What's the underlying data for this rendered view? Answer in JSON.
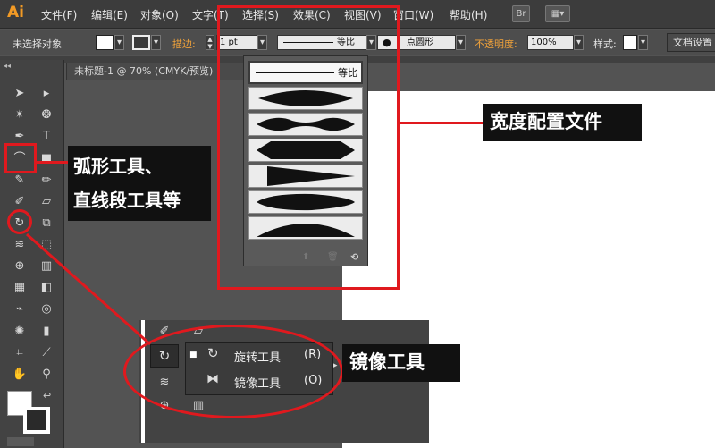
{
  "app": {
    "logo": "Ai"
  },
  "menubar": {
    "items": [
      "文件(F)",
      "编辑(E)",
      "对象(O)",
      "文字(T)",
      "选择(S)",
      "效果(C)",
      "视图(V)",
      "窗口(W)",
      "帮助(H)"
    ],
    "bridge_label": "Br"
  },
  "control_bar": {
    "selection_status": "未选择对象",
    "stroke_label": "描边:",
    "stroke_weight": "1 pt",
    "profile_label": "等比",
    "brush_label": "点圆形",
    "opacity_label": "不透明度:",
    "opacity_value": "100%",
    "style_label": "样式:",
    "doc_settings_label": "文档设置"
  },
  "document": {
    "tab_title": "未标题-1 @ 70% (CMYK/预览)"
  },
  "width_profile_panel": {
    "selected_label": "等比"
  },
  "flyout": {
    "items": [
      {
        "label": "旋转工具",
        "shortcut": "(R)"
      },
      {
        "label": "镜像工具",
        "shortcut": "(O)"
      }
    ]
  },
  "annotations": {
    "arc_tool": "弧形工具、\n直线段工具等",
    "width_profile": "宽度配置文件",
    "reflect_tool": "镜像工具"
  },
  "colors": {
    "annotation_red": "#e0191e",
    "logo_orange": "#f29a25",
    "label_bg": "#111111"
  }
}
